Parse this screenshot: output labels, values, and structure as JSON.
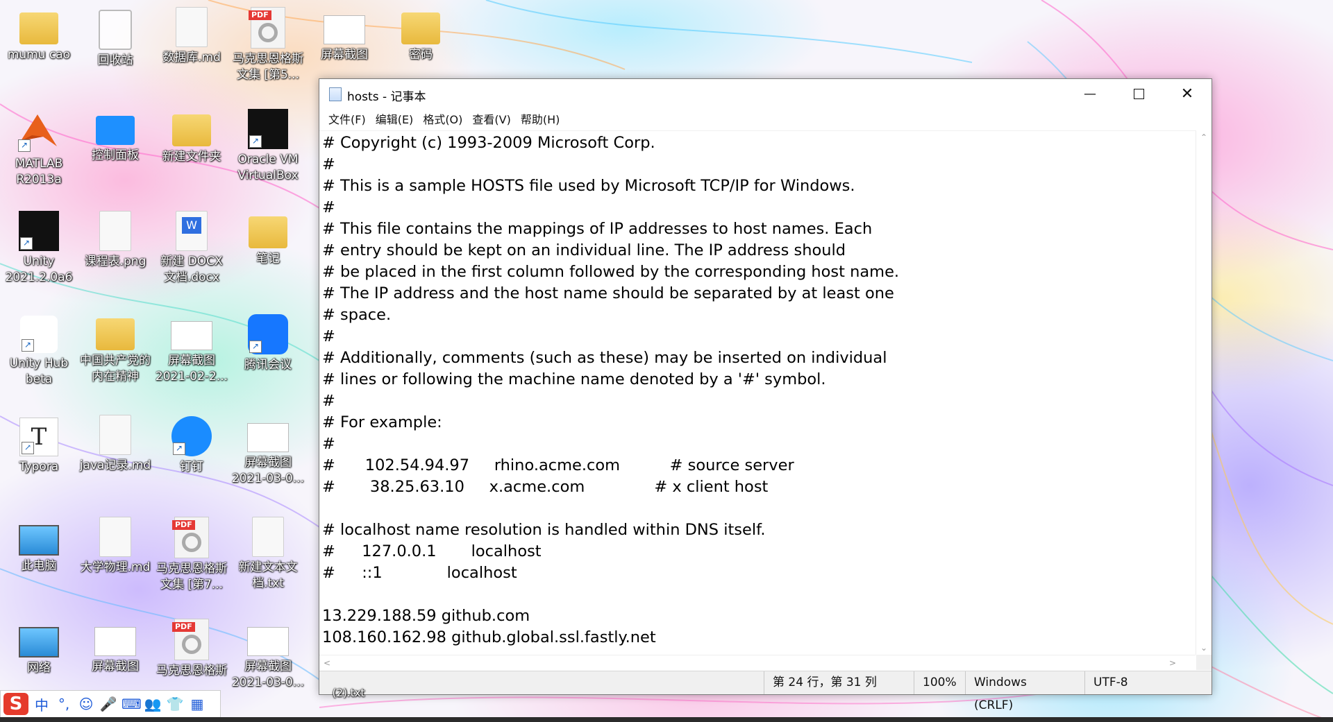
{
  "desktop": {
    "icons": [
      {
        "label": "mumu cao",
        "type": "user-folder-icon"
      },
      {
        "label": "回收站",
        "type": "recycle-bin-icon"
      },
      {
        "label": "数据库.md",
        "type": "file-icon"
      },
      {
        "label": "马克思恩格斯文集 [第5...",
        "type": "pdf-icon"
      },
      {
        "label": "屏幕截图",
        "type": "screenshot-icon"
      },
      {
        "label": "密码",
        "type": "folder-icon"
      },
      {
        "label": "MATLAB R2013a",
        "type": "matlab-icon"
      },
      {
        "label": "控制面板",
        "type": "control-panel-icon"
      },
      {
        "label": "新建文件夹",
        "type": "folder-icon"
      },
      {
        "label": "Oracle VM VirtualBox",
        "type": "virtualbox-icon"
      },
      {
        "label": "Unity 2021.2.0a6",
        "type": "unity-icon"
      },
      {
        "label": "课程表.png",
        "type": "image-file-icon"
      },
      {
        "label": "新建 DOCX 文档.docx",
        "type": "word-doc-icon"
      },
      {
        "label": "笔记",
        "type": "folder-icon"
      },
      {
        "label": "Unity Hub beta",
        "type": "unity-hub-icon"
      },
      {
        "label": "中国共产党的内在精神",
        "type": "folder-icon"
      },
      {
        "label": "屏幕截图 2021-02-2...",
        "type": "screenshot-icon"
      },
      {
        "label": "腾讯会议",
        "type": "tencent-meeting-icon"
      },
      {
        "label": "Typora",
        "type": "typora-icon"
      },
      {
        "label": "java记录.md",
        "type": "file-icon"
      },
      {
        "label": "钉钉",
        "type": "dingtalk-icon"
      },
      {
        "label": "屏幕截图 2021-03-0...",
        "type": "screenshot-icon"
      },
      {
        "label": "此电脑",
        "type": "this-pc-icon"
      },
      {
        "label": "大学物理.md",
        "type": "file-icon"
      },
      {
        "label": "马克思恩格斯文集 [第7...",
        "type": "pdf-icon"
      },
      {
        "label": "新建文本文档.txt",
        "type": "text-file-icon"
      },
      {
        "label": "网络",
        "type": "network-icon"
      },
      {
        "label": "屏幕截图",
        "type": "screenshot-icon"
      },
      {
        "label": "马克思恩格斯",
        "type": "pdf-icon"
      },
      {
        "label": "屏幕截图 2021-03-0...",
        "type": "screenshot-icon"
      }
    ],
    "partial_labels": [
      "(2).txt"
    ]
  },
  "notepad": {
    "title": "hosts - 记事本",
    "menu": [
      "文件(F)",
      "编辑(E)",
      "格式(O)",
      "查看(V)",
      "帮助(H)"
    ],
    "content_lines": [
      "# Copyright (c) 1993-2009 Microsoft Corp.",
      "#",
      "# This is a sample HOSTS file used by Microsoft TCP/IP for Windows.",
      "#",
      "# This file contains the mappings of IP addresses to host names. Each",
      "# entry should be kept on an individual line. The IP address should",
      "# be placed in the first column followed by the corresponding host name.",
      "# The IP address and the host name should be separated by at least one",
      "# space.",
      "#",
      "# Additionally, comments (such as these) may be inserted on individual",
      "# lines or following the machine name denoted by a '#' symbol.",
      "#",
      "# For example:",
      "#",
      "#      102.54.94.97     rhino.acme.com          # source server",
      "#       38.25.63.10     x.acme.com              # x client host",
      "",
      "# localhost name resolution is handled within DNS itself.",
      "#\t127.0.0.1       localhost",
      "#\t::1             localhost",
      "",
      "13.229.188.59 github.com",
      "108.160.162.98 github.global.ssl.fastly.net"
    ],
    "status": {
      "position": "第 24 行，第 31 列",
      "zoom": "100%",
      "line_ending": "Windows (CRLF)",
      "encoding": "UTF-8"
    }
  },
  "ime_bar": {
    "logo": "S",
    "items": [
      {
        "label": "中",
        "icon": "chinese-mode-icon"
      },
      {
        "label": "°,",
        "icon": "punctuation-icon"
      },
      {
        "label": "☺",
        "icon": "emoji-icon"
      },
      {
        "label": "🎤",
        "icon": "microphone-icon"
      },
      {
        "label": "⌨",
        "icon": "keyboard-icon"
      },
      {
        "label": "👥",
        "icon": "user-icon"
      },
      {
        "label": "👕",
        "icon": "skin-icon"
      },
      {
        "label": "▦",
        "icon": "toolbox-icon"
      }
    ]
  }
}
